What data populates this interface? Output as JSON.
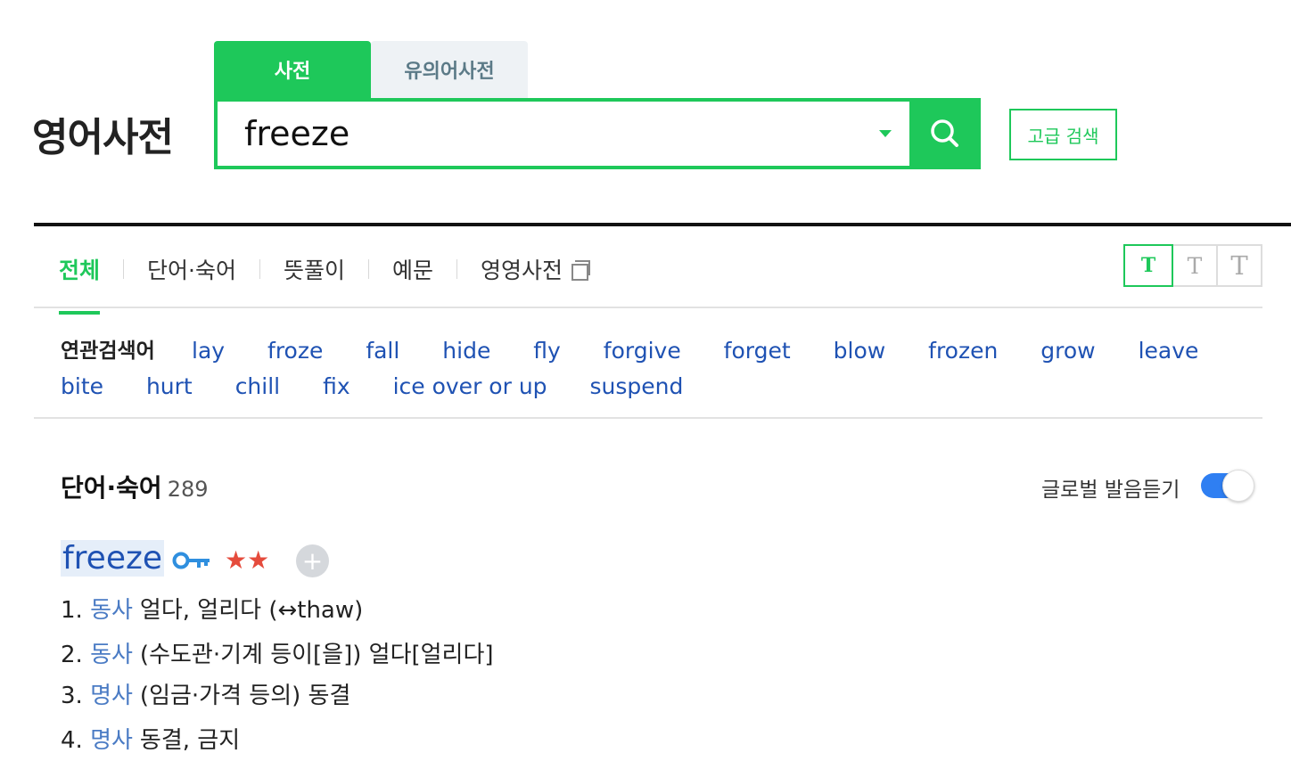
{
  "header": {
    "logo": "영어사전",
    "tabs": [
      {
        "label": "사전",
        "active": true
      },
      {
        "label": "유의어사전",
        "active": false
      }
    ],
    "search": {
      "value": "freeze",
      "placeholder": ""
    },
    "advanced_search": "고급 검색"
  },
  "nav": {
    "items": [
      {
        "label": "전체",
        "active": true
      },
      {
        "label": "단어·숙어",
        "active": false
      },
      {
        "label": "뜻풀이",
        "active": false
      },
      {
        "label": "예문",
        "active": false
      },
      {
        "label": "영영사전",
        "active": false
      }
    ],
    "font_sizes": [
      "T",
      "T",
      "T"
    ]
  },
  "related": {
    "label": "연관검색어",
    "words": [
      "lay",
      "froze",
      "fall",
      "hide",
      "fly",
      "forgive",
      "forget",
      "blow",
      "frozen",
      "grow",
      "leave",
      "bite",
      "hurt",
      "chill",
      "fix",
      "ice over or up",
      "suspend"
    ]
  },
  "section": {
    "title": "단어·숙어",
    "count": "289",
    "global_pronunciation": "글로벌 발음듣기",
    "global_pronunciation_on": true
  },
  "entry": {
    "word": "freeze",
    "stars": "★★",
    "add_symbol": "+",
    "meanings": [
      {
        "num": "1.",
        "pos": "동사",
        "text": "얼다, 얼리다 (↔thaw)"
      },
      {
        "num": "2.",
        "pos": "동사",
        "text": "(수도관·기계 등이[을]) 얼다[얼리다]"
      },
      {
        "num": "3.",
        "pos": "명사",
        "text": "(임금·가격 등의) 동결"
      },
      {
        "num": "4.",
        "pos": "명사",
        "text": "동결, 금지"
      }
    ]
  },
  "colors": {
    "accent": "#1ec85a",
    "link": "#1f52b3",
    "toggle": "#2f7ff2",
    "star": "#e54b3c"
  }
}
